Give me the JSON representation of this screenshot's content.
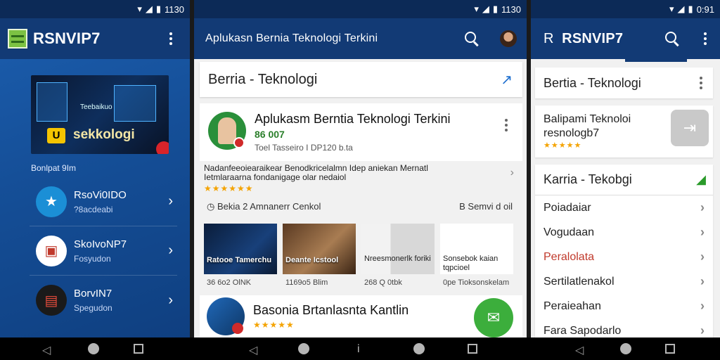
{
  "status": {
    "left_time": "1130",
    "mid_time": "1130",
    "right_time": "0:91"
  },
  "panel1": {
    "title": "RSNVIP7",
    "hero_label": "Teebaikuo",
    "hero_badge": "U",
    "hero_caption": "sekkologi",
    "section_label": "Bonlpat 9Im",
    "items": [
      {
        "title": "RsoVi0IDO",
        "subtitle": "?8acdeabi",
        "icon": "star-icon"
      },
      {
        "title": "SkoIvoNP7",
        "subtitle": "Fosyudon",
        "icon": "devices-icon"
      },
      {
        "title": "BorvIN7",
        "subtitle": "Spegudon",
        "icon": "laptop-icon"
      }
    ]
  },
  "panel2": {
    "title": "Aplukasn Bernia Teknologi Terkini",
    "section_title": "Berria - Teknologi",
    "featured": {
      "title": "Aplukasm Berntia Teknologi Terkini",
      "version": "86 007",
      "meta": "Toel Tasseiro I DP120 b.ta"
    },
    "description": "Nadanfeeoiearaikear Benodkricelalmn Idep aniekan Mernatl Ietmlaraarna fondanigage olar nedaiol",
    "stars": "★★★★★★",
    "meta_left": "Bekia 2 Amnanerr",
    "meta_center": "Cenkol",
    "meta_right": "B Semvi d oil",
    "thumbs": [
      {
        "caption": "Ratooe Tamerchu",
        "sub": "36 6o2 OlNK"
      },
      {
        "caption": "Deante Icstool",
        "sub": "1169o5 Blim"
      },
      {
        "caption": "Nreesmonerlk foriki",
        "sub": "268 Q 0tbk"
      },
      {
        "caption": "Sonsebok kaian tqpcioel",
        "sub": "0pe Tioksonskelam"
      }
    ],
    "bottom_title": "Basonia Brtanlasnta Kantlin",
    "bottom_stars": "★★★★★"
  },
  "panel3": {
    "title_prefix": "R",
    "title": "RSNVIP7",
    "card_a": "Bertia - Teknologi",
    "card_b": "Balipami Teknoloi resnologb7",
    "card_b_stars": "★★★★★",
    "section": "Karria - Tekobgi",
    "menu": [
      {
        "label": "Poiadaiar",
        "red": false
      },
      {
        "label": "Vogudaan",
        "red": false
      },
      {
        "label": "Peralolata",
        "red": true
      },
      {
        "label": "Sertilatlenakol",
        "red": false
      },
      {
        "label": "Peraieahan",
        "red": false
      },
      {
        "label": "Fara Sapodarlo",
        "red": false
      }
    ]
  },
  "navbar": {
    "middle_glyph": "i"
  },
  "colors": {
    "appbar": "#123a75",
    "statusbar": "#0c2a57",
    "accent_green": "#3cae3c",
    "star": "#f4a300"
  }
}
